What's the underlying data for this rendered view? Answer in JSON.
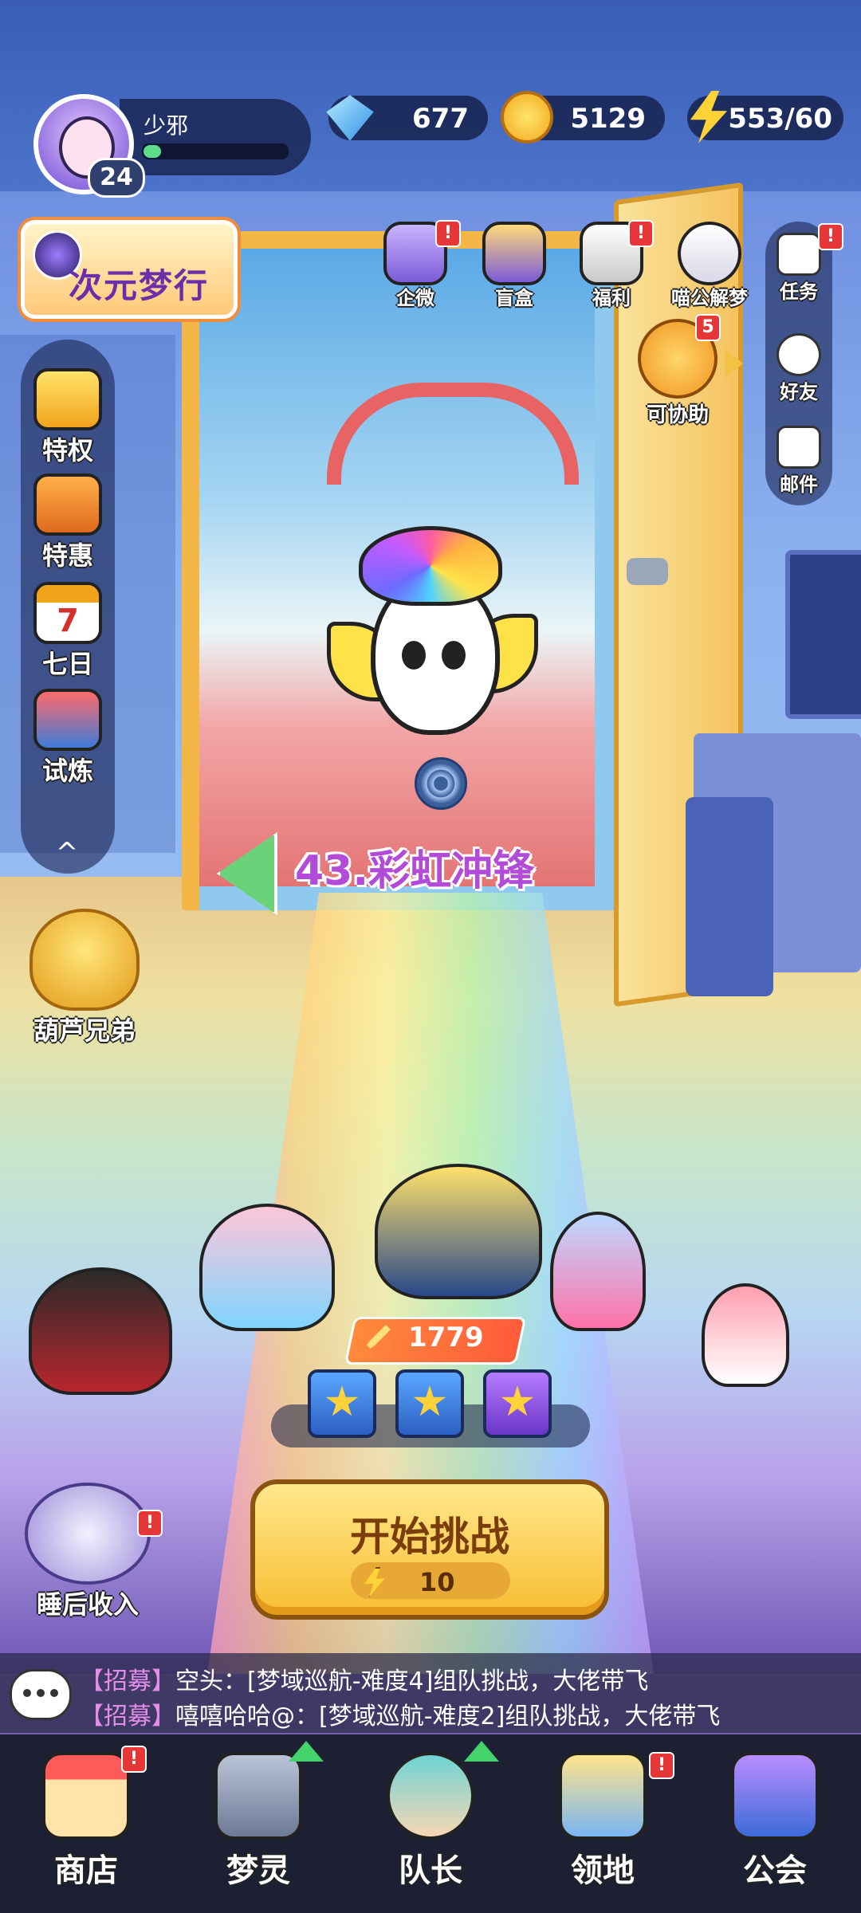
{
  "player": {
    "name": "少邪",
    "level": "24",
    "exp_fraction": 0.12
  },
  "resources": {
    "diamonds": "677",
    "coins": "5129",
    "energy": "553/60"
  },
  "dream_banner": {
    "label": "次元梦行"
  },
  "top_icons": [
    {
      "label": "企微",
      "icon": "gift-icon",
      "badge": "!"
    },
    {
      "label": "盲盒",
      "icon": "card-box-icon",
      "badge": ""
    },
    {
      "label": "福利",
      "icon": "present-icon",
      "badge": "!"
    },
    {
      "label": "喵公解梦",
      "icon": "cat-icon",
      "badge": ""
    }
  ],
  "assist": {
    "label": "可协助",
    "badge": "5",
    "icon": "handshake-icon"
  },
  "right_menu": [
    {
      "label": "任务",
      "icon": "task-icon",
      "badge": "!"
    },
    {
      "label": "好友",
      "icon": "friends-icon",
      "badge": ""
    },
    {
      "label": "邮件",
      "icon": "mail-icon",
      "badge": ""
    }
  ],
  "left_menu": [
    {
      "label": "特权",
      "icon": "privilege-card-icon"
    },
    {
      "label": "特惠",
      "icon": "sale-box-icon"
    },
    {
      "label": "七日",
      "icon": "calendar-icon",
      "day": "7"
    },
    {
      "label": "试炼",
      "icon": "cannon-icon"
    }
  ],
  "left_menu_collapse": "^",
  "stage": {
    "title": "43.彩虹冲锋"
  },
  "gourd": {
    "label": "葫芦兄弟"
  },
  "team": {
    "power": "1779"
  },
  "start": {
    "label": "开始挑战",
    "cost": "10"
  },
  "sleep": {
    "label": "睡后收入",
    "badge": "!"
  },
  "chat": [
    {
      "tag": "【招募】",
      "text": "空头：[梦域巡航-难度4]组队挑战，大佬带飞"
    },
    {
      "tag": "【招募】",
      "text": "嘻嘻哈哈@：[梦域巡航-难度2]组队挑战，大佬带飞"
    }
  ],
  "nav": [
    {
      "label": "商店",
      "icon": "shop-icon",
      "badge": "!"
    },
    {
      "label": "梦灵",
      "icon": "robot-icon",
      "upgrade": true
    },
    {
      "label": "队长",
      "icon": "captain-icon",
      "upgrade": true
    },
    {
      "label": "领地",
      "icon": "territory-door-icon",
      "badge": "!"
    },
    {
      "label": "公会",
      "icon": "guild-icon",
      "badge": ""
    }
  ],
  "colors": {
    "accent": "#f7bd33",
    "badge": "#e53737",
    "stage_title": "#b24bd8",
    "nav_bg": "#1d1f33"
  }
}
